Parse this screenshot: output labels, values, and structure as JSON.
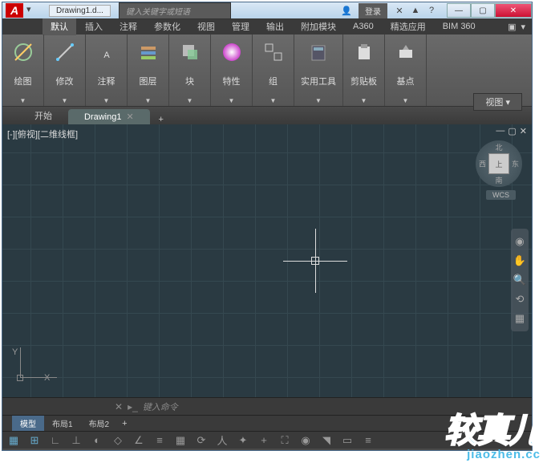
{
  "titlebar": {
    "doc": "Drawing1.d...",
    "search_placeholder": "键入关键字或短语",
    "login": "登录"
  },
  "tabs": {
    "items": [
      "默认",
      "插入",
      "注释",
      "参数化",
      "视图",
      "管理",
      "输出",
      "附加模块",
      "A360",
      "精选应用",
      "BIM 360"
    ],
    "active": 0
  },
  "ribbon": {
    "panels": [
      {
        "label": "绘图",
        "icon": "draw"
      },
      {
        "label": "修改",
        "icon": "modify"
      },
      {
        "label": "注释",
        "icon": "text"
      },
      {
        "label": "图层",
        "icon": "layers"
      },
      {
        "label": "块",
        "icon": "block"
      },
      {
        "label": "特性",
        "icon": "props"
      },
      {
        "label": "组",
        "icon": "group"
      },
      {
        "label": "实用工具",
        "icon": "util"
      },
      {
        "label": "剪贴板",
        "icon": "clip"
      },
      {
        "label": "基点",
        "icon": "base"
      }
    ],
    "view_dd": "视图"
  },
  "file_tabs": {
    "items": [
      "开始",
      "Drawing1"
    ],
    "active": 1
  },
  "canvas": {
    "view_label": "[-][俯视][二维线框]",
    "wcs": "WCS",
    "compass": {
      "n": "北",
      "s": "南",
      "e": "东",
      "w": "西",
      "face": "上"
    }
  },
  "cmdline": {
    "prompt": "键入命令"
  },
  "layout_tabs": {
    "items": [
      "模型",
      "布局1",
      "布局2"
    ],
    "active": 0
  },
  "ucs": {
    "x": "X",
    "y": "Y"
  },
  "watermark": {
    "main": "较真儿",
    "sub": "jiaozhen.cc"
  }
}
